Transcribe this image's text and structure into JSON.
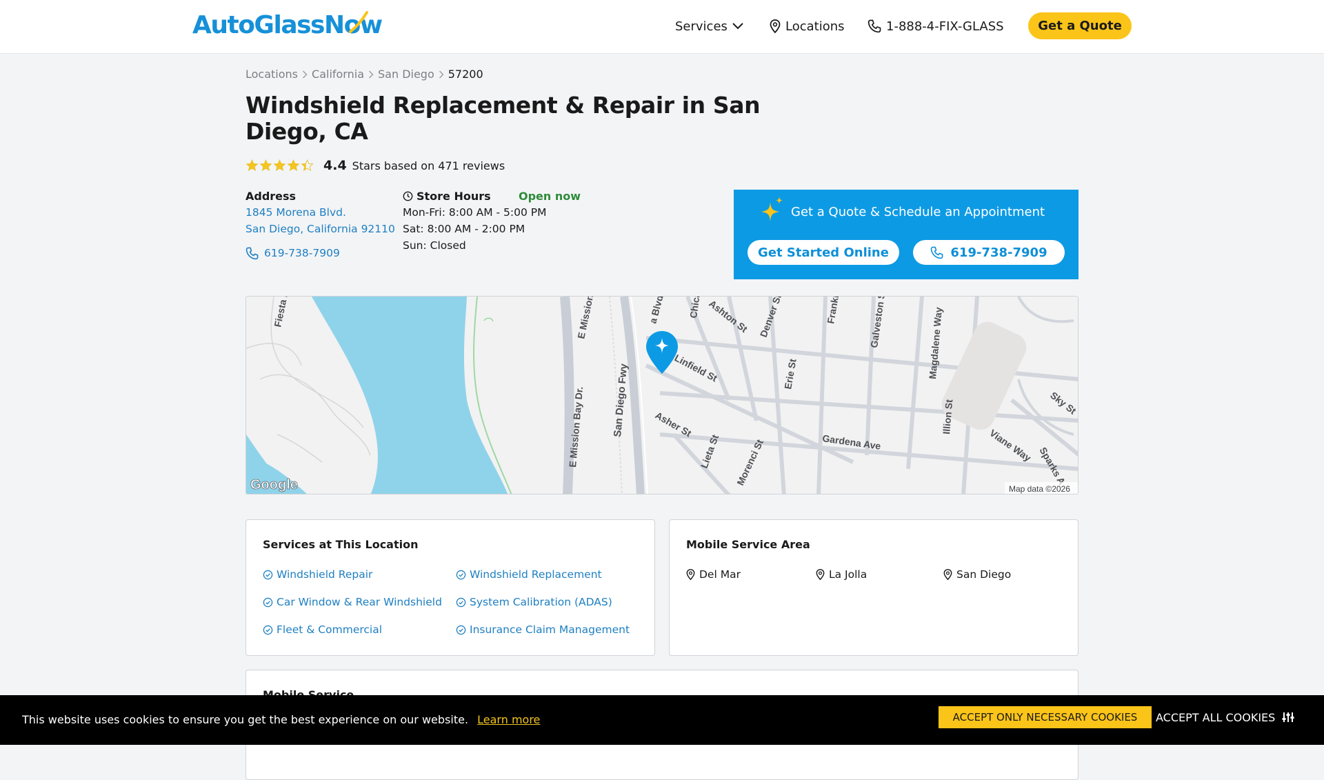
{
  "header": {
    "logo": "AutoGlassNow",
    "nav": {
      "services": "Services",
      "locations": "Locations",
      "phone": "1-888-4-FIX-GLASS",
      "quote": "Get a Quote"
    }
  },
  "breadcrumb": [
    "Locations",
    "California",
    "San Diego",
    "57200"
  ],
  "title": "Windshield Replacement & Repair in San Diego, CA",
  "rating": {
    "value": "4.4",
    "text": "Stars based on 471 reviews",
    "stars_filled": 4.4
  },
  "address": {
    "label": "Address",
    "line1": "1845 Morena Blvd.",
    "line2": "San Diego, California 92110",
    "phone": "619-738-7909"
  },
  "hours": {
    "label": "Store Hours",
    "status": "Open now",
    "lines": [
      "Mon-Fri: 8:00 AM - 5:00 PM",
      "Sat: 8:00 AM - 2:00 PM",
      "Sun: Closed"
    ]
  },
  "cta": {
    "title": "Get a Quote & Schedule an Appointment",
    "online": "Get Started Online",
    "phone": "619-738-7909"
  },
  "map": {
    "attribution": "Map data ©2026",
    "google": "Google",
    "streets": [
      "Fiesta I",
      "E Mission",
      "E Mission Bay Dr.",
      "San Diego Fwy",
      "a Blvd",
      "Chica",
      "Ashton St",
      "Denver St",
      "Frankl",
      "Galveston S",
      "Magdalene Way",
      "Erie St",
      "Illion St",
      "Sky St",
      "Viane Way",
      "Sparks A",
      "Gardena Ave",
      "Asher St",
      "Lieta St",
      "Morenci St",
      "Linfield St"
    ]
  },
  "services_card": {
    "title": "Services at This Location",
    "items": [
      "Windshield Repair",
      "Windshield Replacement",
      "Car Window & Rear Windshield",
      "System Calibration (ADAS)",
      "Fleet & Commercial",
      "Insurance Claim Management"
    ]
  },
  "area_card": {
    "title": "Mobile Service Area",
    "items": [
      "Del Mar",
      "La Jolla",
      "San Diego"
    ]
  },
  "mobile_card": {
    "title": "Mobile Service"
  },
  "cookie": {
    "text": "This website uses cookies to ensure you get the best experience on our website.",
    "learn": "Learn more",
    "necessary": "ACCEPT ONLY NECESSARY COOKIES",
    "all": "ACCEPT ALL COOKIES"
  },
  "colors": {
    "brand_blue": "#1690d8",
    "accent_yellow": "#fbc418",
    "link_blue": "#1e7fc2",
    "open_green": "#2e8b3a",
    "cta_blue": "#0d9ae4"
  }
}
